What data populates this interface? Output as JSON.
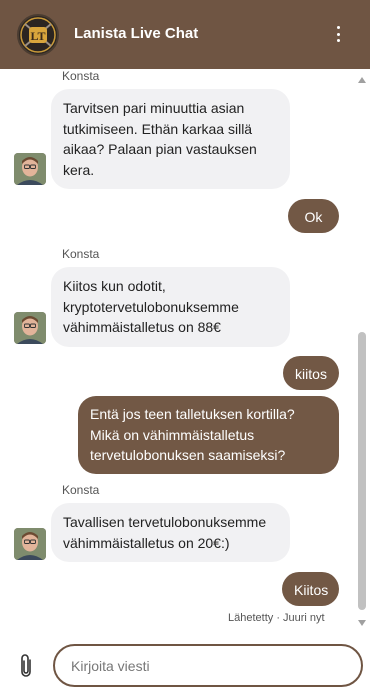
{
  "header": {
    "logo_text": "LT",
    "title": "Lanista Live Chat",
    "menu_icon": "kebab-menu-icon"
  },
  "messages": [
    {
      "from": "agent",
      "sender": "Konsta",
      "text": "Tarvitsen pari minuuttia asian tutkimiseen. Ethän karkaa sillä aikaa? Palaan pian vastauksen kera."
    },
    {
      "from": "user",
      "text": "Ok"
    },
    {
      "from": "agent",
      "sender": "Konsta",
      "text": "Kiitos kun odotit, kryptotervetulobonuksemme vähimmäistalletus on 88€"
    },
    {
      "from": "user",
      "text": "kiitos"
    },
    {
      "from": "user",
      "text": "Entä jos teen talletuksen kortilla? Mikä on vähimmäistalletus tervetulobonuksen saamiseksi?"
    },
    {
      "from": "agent",
      "sender": "Konsta",
      "text": "Tavallisen tervetulobonuksemme vähimmäistalletus on 20€:)"
    },
    {
      "from": "user",
      "text": "Kiitos"
    }
  ],
  "delivery_status": "Lähetetty · Juuri nyt",
  "composer": {
    "placeholder": "Kirjoita viesti",
    "attach_icon": "paperclip-icon"
  },
  "colors": {
    "header_bg": "#6f5543",
    "outgoing_bubble": "#725845",
    "incoming_bubble": "#f1f1f3"
  }
}
